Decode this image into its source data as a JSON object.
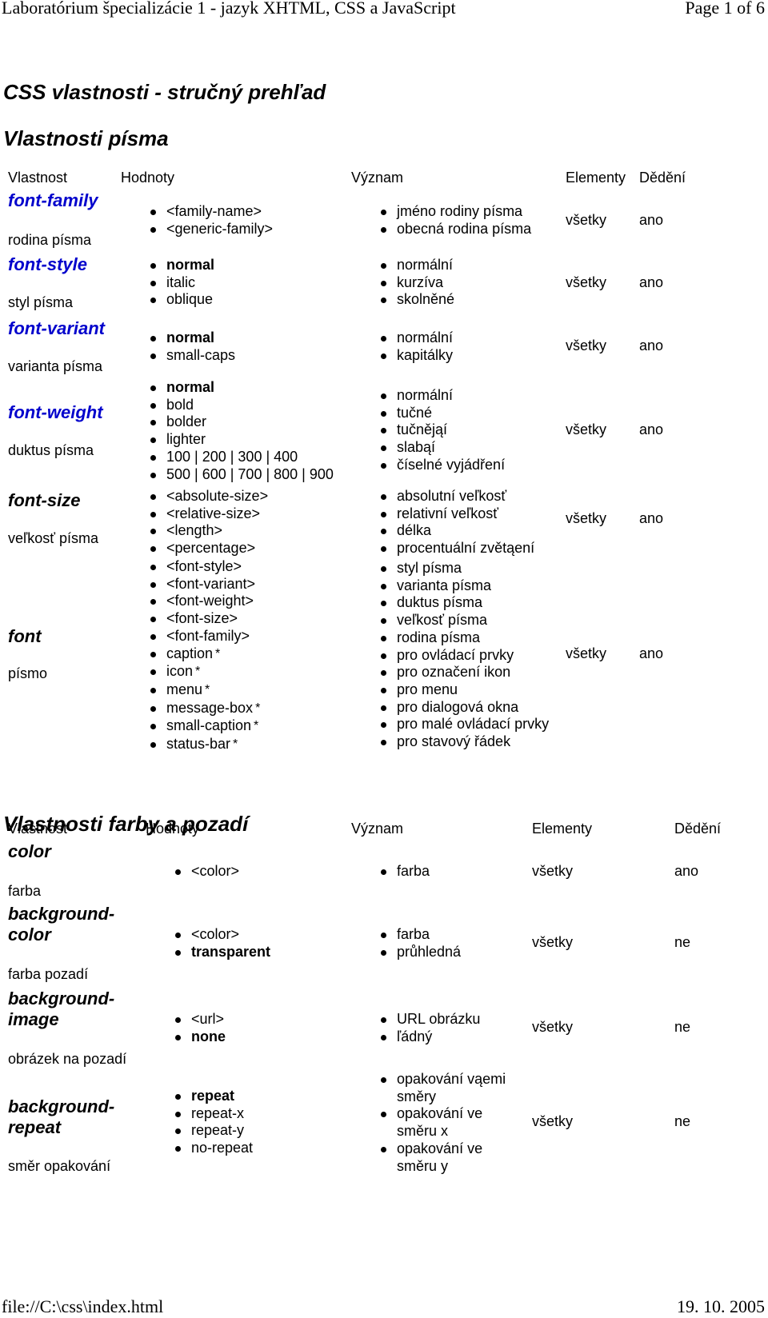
{
  "header": {
    "title": "Laboratórium špecializácie 1 - jazyk XHTML, CSS a JavaScript",
    "page": "Page 1 of 6"
  },
  "footer": {
    "url": "file://C:\\css\\index.html",
    "date": "19. 10. 2005"
  },
  "page_title": "CSS vlastnosti - stručný prehľad",
  "font_section": {
    "title": "Vlastnosti písma",
    "columns": [
      "Vlastnost",
      "Hodnoty",
      "Význam",
      "Elementy",
      "Dědění"
    ],
    "rows": [
      {
        "property": "font-family",
        "description": "rodina písma",
        "values": [
          "<family-name>",
          "<generic-family>"
        ],
        "meanings": [
          "jméno rodiny písma",
          "obecná rodina písma"
        ],
        "elements": "všetky",
        "inherit": "ano"
      },
      {
        "property": "font-style",
        "description": "styl písma",
        "values": [
          "normal",
          "italic",
          "oblique"
        ],
        "meanings": [
          "normální",
          "kurzíva",
          "skolněné"
        ],
        "elements": "všetky",
        "inherit": "ano"
      },
      {
        "property": "font-variant",
        "description": "varianta písma",
        "values": [
          "normal",
          "small-caps"
        ],
        "meanings": [
          "normální",
          "kapitálky"
        ],
        "elements": "všetky",
        "inherit": "ano"
      },
      {
        "property": "font-weight",
        "description": "duktus písma",
        "values": [
          "normal",
          "bold",
          "bolder",
          "lighter",
          "100 | 200 | 300 | 400",
          "500 | 600 | 700 | 800 | 900"
        ],
        "meanings": [
          "normální",
          "tučné",
          "tučnějąí",
          "slabąí",
          "číselné vyjádření"
        ],
        "elements": "všetky",
        "inherit": "ano"
      },
      {
        "property": "font-size",
        "description": "veľkosť písma",
        "values": [
          "<absolute-size>",
          "<relative-size>",
          "<length>",
          "<percentage>"
        ],
        "meanings": [
          "absolutní veľkosť",
          "relativní veľkosť",
          "délka",
          "procentuální zvětąení"
        ],
        "elements": "všetky",
        "inherit": "ano"
      },
      {
        "property": "font",
        "description": "písmo",
        "values": [
          "<font-style>",
          "<font-variant>",
          "<font-weight>",
          "<font-size>",
          "<font-family>",
          "caption",
          "icon",
          "menu",
          "message-box",
          "small-caption",
          "status-bar"
        ],
        "meanings": [
          "styl písma",
          "varianta písma",
          "duktus písma",
          "veľkosť písma",
          "rodina písma",
          "pro ovládací prvky",
          "pro označení ikon",
          "pro menu",
          "pro dialogová okna",
          "pro malé ovládací prvky",
          "pro stavový řádek"
        ],
        "elements": "všetky",
        "inherit": "ano"
      }
    ]
  },
  "color_section": {
    "title": "Vlastnosti farby a pozadí",
    "columns": [
      "Vlastnost",
      "Hodnoty",
      "Význam",
      "Elementy",
      "Dědění"
    ],
    "rows": [
      {
        "property": "color",
        "description": "farba",
        "values": [
          "<color>"
        ],
        "meanings": [
          "farba"
        ],
        "elements": "všetky",
        "inherit": "ano"
      },
      {
        "property_lines": [
          "background-",
          "color"
        ],
        "description": "farba pozadí",
        "values": [
          "<color>",
          "transparent"
        ],
        "meanings": [
          "farba",
          "průhledná"
        ],
        "elements": "všetky",
        "inherit": "ne"
      },
      {
        "property_lines": [
          "background-",
          "image"
        ],
        "description": "obrázek na pozadí",
        "values": [
          "<url>",
          "none"
        ],
        "meanings": [
          "URL obrázku",
          "ľádný"
        ],
        "elements": "všetky",
        "inherit": "ne"
      },
      {
        "property_lines": [
          "background-",
          "repeat"
        ],
        "description": "směr opakování",
        "values": [
          "repeat",
          "repeat-x",
          "repeat-y",
          "no-repeat"
        ],
        "meanings": [
          "opakování vąemi",
          "směry",
          "opakování ve",
          "směru x",
          "opakování ve",
          "směru y"
        ],
        "elements": "všetky",
        "inherit": "ne"
      }
    ]
  },
  "star": "*",
  "colors": {
    "link": "#0000cc",
    "text": "#000000"
  }
}
